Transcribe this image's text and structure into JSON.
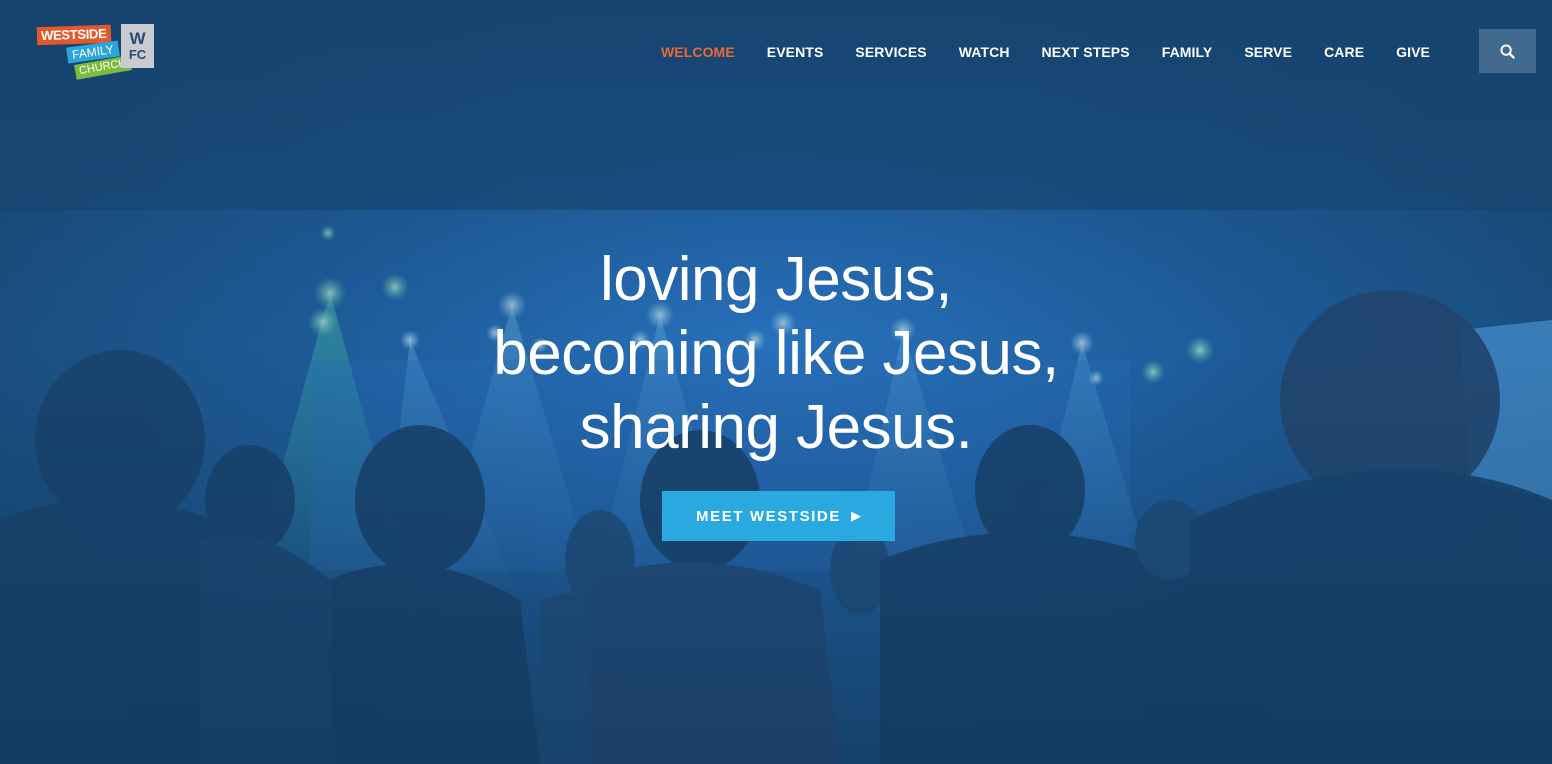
{
  "logo": {
    "westside": "WESTSIDE",
    "family": "FAMILY",
    "church": "CHURCH",
    "mark_line1": "W",
    "mark_line2": "FC"
  },
  "nav": {
    "items": [
      {
        "label": "WELCOME",
        "active": true
      },
      {
        "label": "EVENTS"
      },
      {
        "label": "SERVICES"
      },
      {
        "label": "WATCH"
      },
      {
        "label": "NEXT STEPS"
      },
      {
        "label": "FAMILY"
      },
      {
        "label": "SERVE"
      },
      {
        "label": "CARE"
      },
      {
        "label": "GIVE"
      }
    ]
  },
  "search": {
    "icon": "search-icon"
  },
  "hero": {
    "line1": "loving Jesus,",
    "line2": "becoming like Jesus,",
    "line3": "sharing Jesus.",
    "cta_label": "MEET WESTSIDE",
    "cta_icon": "▶"
  },
  "colors": {
    "accent_active": "#ea6a33",
    "cta": "#29a9e0",
    "overlay": "#1d4c7a"
  }
}
